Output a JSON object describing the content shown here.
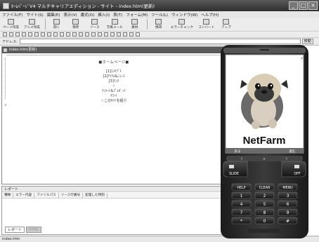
{
  "window": {
    "title": "ﾎｰﾑﾍﾟｰｼﾞV4 マルチキャリアエディション - サイト - index.htm(更新)",
    "controls": [
      "_",
      "□",
      "×"
    ]
  },
  "menu": [
    "ファイル(F)",
    "サイト(S)",
    "編集(E)",
    "表示(V)",
    "書式(O)",
    "挿入(I)",
    "表(T)",
    "フォーム(M)",
    "ツール(L)",
    "ウィンドウ(W)",
    "ヘルプ(H)"
  ],
  "toolbar": [
    {
      "label": "ページ作成",
      "icon": "new-page-icon"
    },
    {
      "label": "アニメ作成",
      "icon": "animation-icon"
    },
    {
      "label": "開く",
      "icon": "open-folder-icon"
    },
    {
      "label": "保存",
      "icon": "save-icon"
    },
    {
      "label": "ソース",
      "icon": "source-icon"
    },
    {
      "label": "写真メール",
      "icon": "photo-mail-icon"
    },
    {
      "label": "素材",
      "icon": "materials-icon"
    },
    {
      "label": "携帯",
      "icon": "mobile-icon"
    },
    {
      "label": "エラーチェック",
      "icon": "error-check-icon"
    },
    {
      "label": "コンバート",
      "icon": "convert-icon"
    },
    {
      "label": "アップ",
      "icon": "upload-icon"
    }
  ],
  "address": {
    "label": "アドレス:",
    "go_label": "移動"
  },
  "document": {
    "tab_title": "index.htm(更新)",
    "page_top": "■ホームページ■",
    "menu_lines": [
      "[1]ｺﾝｾﾌﾟﾄ",
      "[2]ｱｲﾃﾑ&ﾆｭｰｽ",
      "[3]ﾘﾝｸ",
      "ｱﾝｹｰﾄ&ﾌﾟﾚｾﾞﾝﾄ",
      "ﾔﾌｰ!",
      "☆このｻｲﾄを紹介"
    ]
  },
  "report": {
    "title": "レポート",
    "columns": [
      "種類",
      "エラー内容",
      "ファイルパス",
      "ソース行番号",
      "処理した時刻"
    ],
    "tabs": [
      "レポート",
      "HTML"
    ]
  },
  "statusbar": {
    "text": "index.htm"
  },
  "phone": {
    "brand": "NetFarm",
    "softkeys": [
      "戻る",
      "進む"
    ],
    "top_keys": [
      "I",
      "∨",
      "I"
    ],
    "left_buttons": [
      "SLIDE"
    ],
    "right_buttons": [
      "OFF"
    ],
    "function_keys": [
      "HELP",
      "CLEAR",
      "MENU"
    ],
    "keypad": [
      "1",
      "2",
      "3",
      "4",
      "5",
      "6",
      "7",
      "8",
      "9",
      "*",
      "0",
      "#"
    ]
  }
}
